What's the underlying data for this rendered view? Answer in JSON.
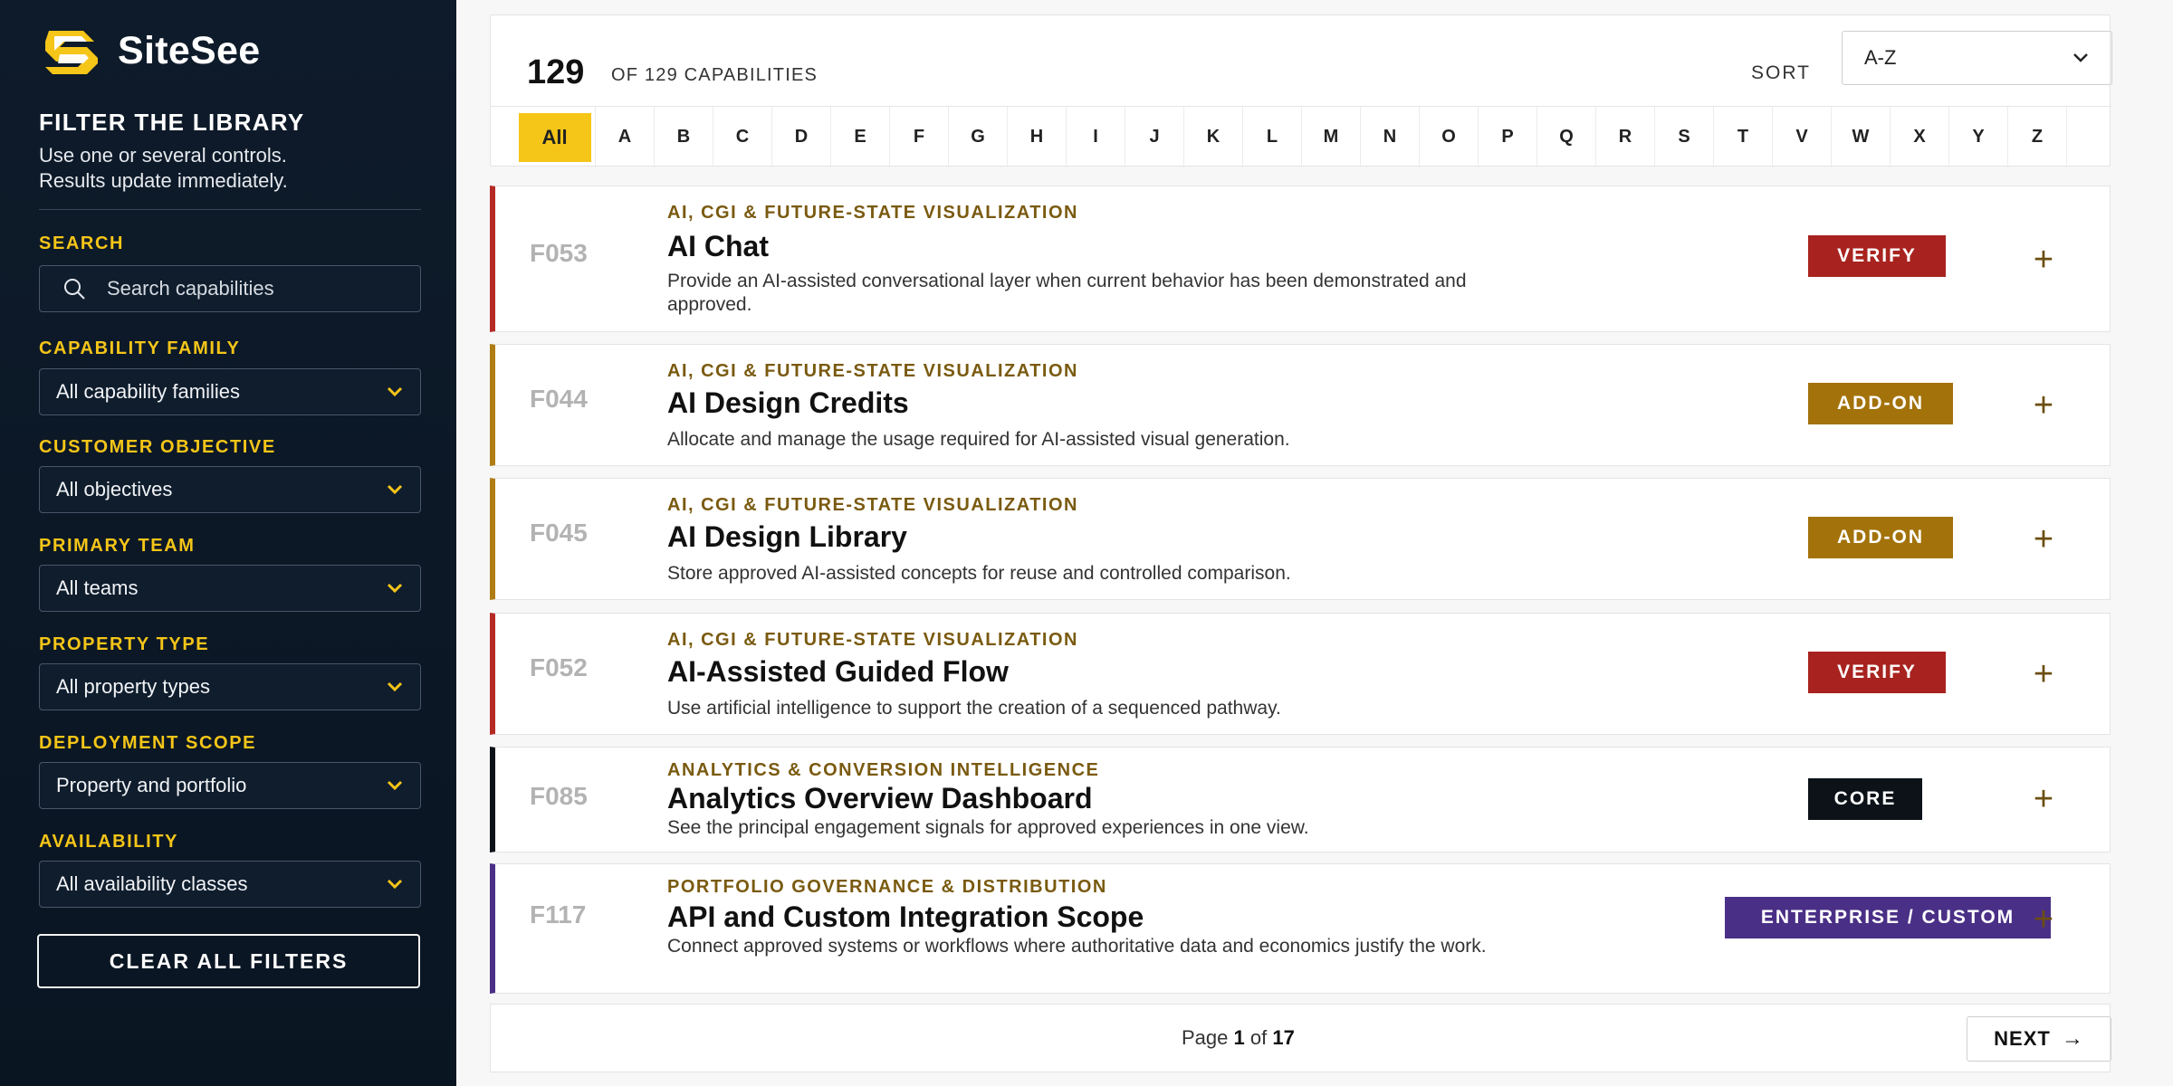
{
  "brand": {
    "name": "SiteSee"
  },
  "sidebar": {
    "title": "FILTER THE LIBRARY",
    "subtitle_line1": "Use one or several controls.",
    "subtitle_line2": "Results update immediately.",
    "search": {
      "label": "SEARCH",
      "placeholder": "Search capabilities"
    },
    "filters": [
      {
        "label": "CAPABILITY FAMILY",
        "value": "All capability families"
      },
      {
        "label": "CUSTOMER OBJECTIVE",
        "value": "All objectives"
      },
      {
        "label": "PRIMARY TEAM",
        "value": "All teams"
      },
      {
        "label": "PROPERTY TYPE",
        "value": "All property types"
      },
      {
        "label": "DEPLOYMENT SCOPE",
        "value": "Property and portfolio"
      },
      {
        "label": "AVAILABILITY",
        "value": "All availability classes"
      }
    ],
    "clear_label": "CLEAR ALL FILTERS"
  },
  "results": {
    "count": "129",
    "count_label": "OF 129 CAPABILITIES",
    "sort_label": "SORT",
    "sort_value": "A-Z"
  },
  "alphabet": [
    "All",
    "A",
    "B",
    "C",
    "D",
    "E",
    "F",
    "G",
    "H",
    "I",
    "J",
    "K",
    "L",
    "M",
    "N",
    "O",
    "P",
    "Q",
    "R",
    "S",
    "T",
    "V",
    "W",
    "X",
    "Y",
    "Z"
  ],
  "alphabet_active": "All",
  "cards": [
    {
      "id": "F053",
      "category": "AI, CGI & FUTURE-STATE VISUALIZATION",
      "title": "AI Chat",
      "description": "Provide an AI-assisted conversational layer when current behavior has been demonstrated and approved.",
      "badge": "VERIFY",
      "badge_color": "#a8231f",
      "accent": "#b52a24"
    },
    {
      "id": "F044",
      "category": "AI, CGI & FUTURE-STATE VISUALIZATION",
      "title": "AI Design Credits",
      "description": "Allocate and manage the usage required for AI-assisted visual generation.",
      "badge": "ADD-ON",
      "badge_color": "#a3720a",
      "accent": "#b07d14"
    },
    {
      "id": "F045",
      "category": "AI, CGI & FUTURE-STATE VISUALIZATION",
      "title": "AI Design Library",
      "description": "Store approved AI-assisted concepts for reuse and controlled comparison.",
      "badge": "ADD-ON",
      "badge_color": "#a3720a",
      "accent": "#b07d14"
    },
    {
      "id": "F052",
      "category": "AI, CGI & FUTURE-STATE VISUALIZATION",
      "title": "AI-Assisted Guided Flow",
      "description": "Use artificial intelligence to support the creation of a sequenced pathway.",
      "badge": "VERIFY",
      "badge_color": "#a8231f",
      "accent": "#b52a24"
    },
    {
      "id": "F085",
      "category": "ANALYTICS & CONVERSION INTELLIGENCE",
      "title": "Analytics Overview Dashboard",
      "description": "See the principal engagement signals for approved experiences in one view.",
      "badge": "CORE",
      "badge_color": "#0c1218",
      "accent": "#0c1218"
    },
    {
      "id": "F117",
      "category": "PORTFOLIO GOVERNANCE & DISTRIBUTION",
      "title": "API and Custom Integration Scope",
      "description": "Connect approved systems or workflows where authoritative data and economics justify the work.",
      "badge": "ENTERPRISE / CUSTOM",
      "badge_color": "#4a2f86",
      "accent": "#4a2f86"
    }
  ],
  "pagination": {
    "page_word": "Page",
    "current": "1",
    "of_word": "of",
    "total": "17",
    "next_label": "NEXT"
  }
}
